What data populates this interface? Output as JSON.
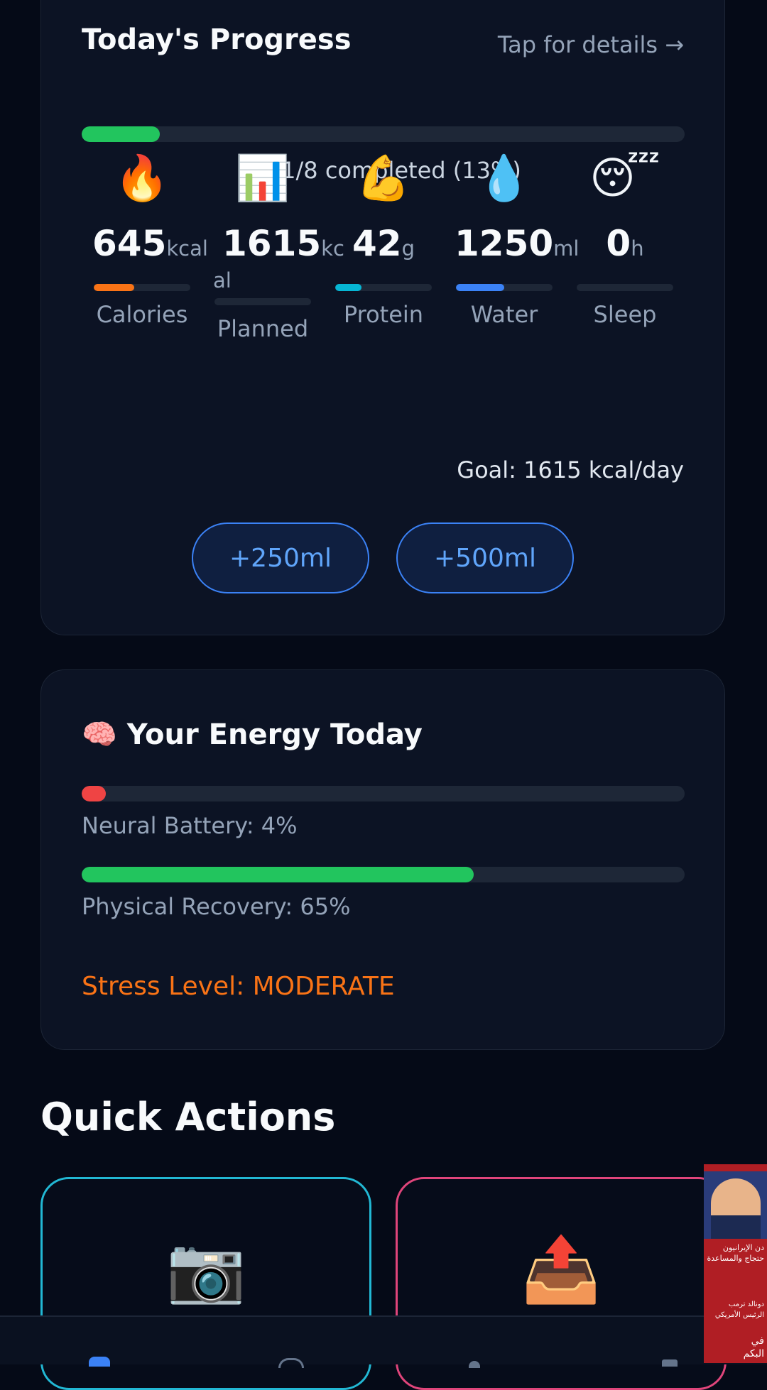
{
  "progress": {
    "title": "Today's Progress",
    "tap_link": "Tap for details →",
    "overall_fraction": 0.13,
    "completed_text": "✅ 1/8 completed (13%)",
    "stats": [
      {
        "icon": "🔥",
        "icon_name": "fire-icon",
        "value": "645",
        "unit": "kcal",
        "label": "Calories",
        "fraction": 0.42,
        "color": "#f97316"
      },
      {
        "icon": "📊",
        "icon_name": "bar-chart-icon",
        "value": "1615",
        "unit_line1": "kc",
        "unit_line2": "al",
        "label": "Planned",
        "fraction": 0,
        "color": "#64748b"
      },
      {
        "icon": "💪",
        "icon_name": "flexed-arm-icon",
        "value": "42",
        "unit": "g",
        "label": "Protein",
        "fraction": 0.27,
        "color": "#06b6d4"
      },
      {
        "icon": "💧",
        "icon_name": "water-drop-icon",
        "value": "1250",
        "unit": "ml",
        "label": "Water",
        "fraction": 0.5,
        "color": "#3b82f6"
      },
      {
        "icon": "😴",
        "icon_name": "sleeping-face-icon",
        "value": "0",
        "unit": "h",
        "label": "Sleep",
        "fraction": 0,
        "color": "#64748b"
      }
    ],
    "goal_text": "Goal: 1615 kcal/day",
    "buttons": {
      "add_250": "+250ml",
      "add_500": "+500ml"
    }
  },
  "energy": {
    "icon": "🧠",
    "title": "Your Energy Today",
    "neural_fraction": 0.04,
    "neural_label": "Neural Battery: 4%",
    "physical_fraction": 0.65,
    "physical_label": "Physical Recovery: 65%",
    "stress_label": "Stress Level: MODERATE"
  },
  "quick_actions": {
    "title": "Quick Actions",
    "items": [
      {
        "icon": "📷",
        "icon_name": "camera-icon",
        "border": "#22b8d4"
      },
      {
        "icon": "📤",
        "icon_name": "upload-tray-icon",
        "border": "#e0457b"
      }
    ]
  },
  "news_widget": {
    "line1": "دن الإيرانيون",
    "line2": "حتجاج والمساعدة",
    "line3": "دونالد ترمب",
    "line4": "الرئيس الأمريكي",
    "line5": "في",
    "line6": "البكم"
  },
  "colors": {
    "background": "#050a17",
    "card": "#0c1324",
    "green": "#22c55e",
    "red": "#ef4444",
    "orange": "#f97316",
    "blue": "#3b82f6"
  }
}
